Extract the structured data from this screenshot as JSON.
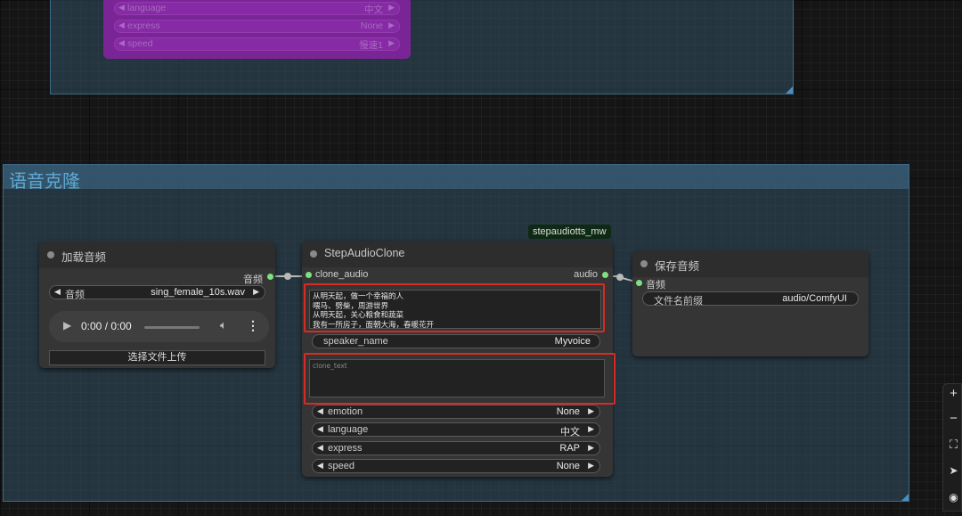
{
  "top_group": {
    "purple_node": {
      "widgets": [
        {
          "name": "language",
          "value": "中文"
        },
        {
          "name": "express",
          "value": "None"
        },
        {
          "name": "speed",
          "value": "慢速1"
        }
      ]
    }
  },
  "group": {
    "title": "语音克隆"
  },
  "node_badge": "stepaudiotts_mw",
  "load_audio_node": {
    "title": "加载音频",
    "output_label": "音频",
    "audio_combo": {
      "name": "音频",
      "value": "sing_female_10s.wav"
    },
    "player_time": "0:00 / 0:00",
    "upload_button": "选择文件上传"
  },
  "step_audio_clone_node": {
    "title": "StepAudioClone",
    "input_label": "clone_audio",
    "output_label": "audio",
    "text_lines": [
      "从明天起，做一个幸福的人",
      "喂马、劈柴，周游世界",
      "从明天起，关心粮食和蔬菜",
      "我有一所房子，面朝大海，春暖花开"
    ],
    "speaker_name": {
      "name": "speaker_name",
      "value": "Myvoice"
    },
    "clone_text_placeholder": "clone_text",
    "widgets": [
      {
        "name": "emotion",
        "value": "None"
      },
      {
        "name": "language",
        "value": "中文"
      },
      {
        "name": "express",
        "value": "RAP"
      },
      {
        "name": "speed",
        "value": "None"
      }
    ]
  },
  "save_audio_node": {
    "title": "保存音频",
    "input_label": "音频",
    "prefix_widget": {
      "name": "文件名前缀",
      "value": "audio/ComfyUI"
    }
  },
  "toolbar": {
    "icons": [
      "plus-icon",
      "minus-icon",
      "fit-view-icon",
      "navigate-icon",
      "eye-icon"
    ],
    "plus": "+",
    "minus": "−",
    "fit": "⛶",
    "nav": "➤",
    "eye": "◉"
  }
}
